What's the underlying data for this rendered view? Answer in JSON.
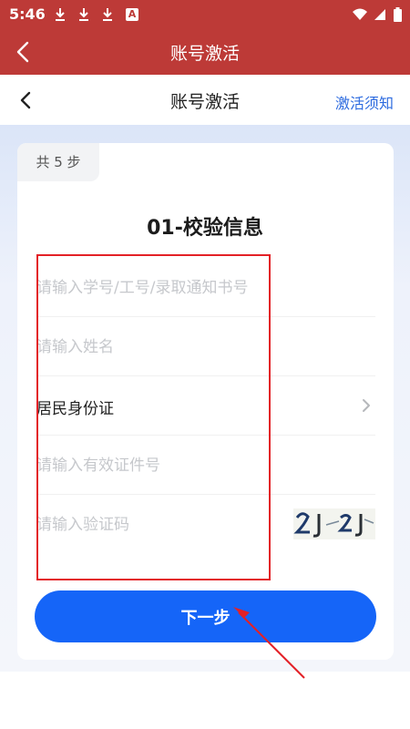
{
  "status": {
    "time": "5:46",
    "app_badge": "A"
  },
  "appbar": {
    "title": "账号激活"
  },
  "web_header": {
    "title": "账号激活",
    "notice_link": "激活须知"
  },
  "card": {
    "steps_badge": "共 5 步",
    "step_title": "01-校验信息",
    "fields": {
      "id_number_placeholder": "请输入学号/工号/录取通知书号",
      "name_placeholder": "请输入姓名",
      "id_type_value": "居民身份证",
      "cert_number_placeholder": "请输入有效证件号",
      "captcha_placeholder": "请输入验证码"
    },
    "next_button": "下一步"
  },
  "colors": {
    "header_red": "#bd3a37",
    "primary_blue": "#1565f8",
    "link_blue": "#2d6bdf",
    "annotation_red": "#e32127"
  }
}
